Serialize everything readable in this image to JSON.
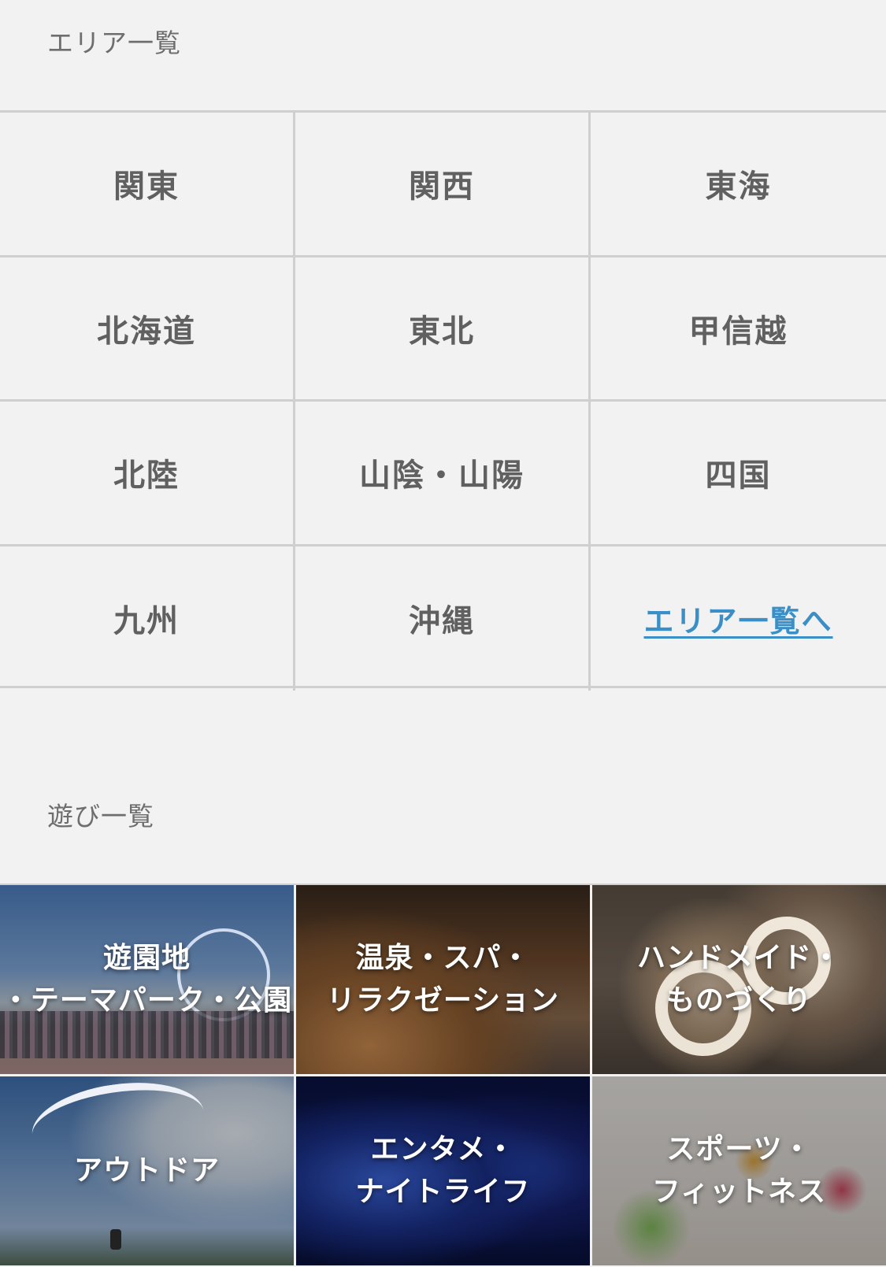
{
  "area_section": {
    "title": "エリア一覧",
    "items": [
      {
        "label": "関東"
      },
      {
        "label": "関西"
      },
      {
        "label": "東海"
      },
      {
        "label": "北海道"
      },
      {
        "label": "東北"
      },
      {
        "label": "甲信越"
      },
      {
        "label": "北陸"
      },
      {
        "label": "山陰・山陽"
      },
      {
        "label": "四国"
      },
      {
        "label": "九州"
      },
      {
        "label": "沖縄"
      }
    ],
    "more_link": "エリア一覧へ",
    "link_color": "#3a8fc7"
  },
  "play_section": {
    "title": "遊び一覧",
    "items": [
      {
        "label": "遊園地\n・テーマパーク・公園",
        "icon": "amusement-park-photo"
      },
      {
        "label": "温泉・スパ・\nリラクゼーション",
        "icon": "hot-spring-photo"
      },
      {
        "label": "ハンドメイド・\nものづくり",
        "icon": "handmade-craft-photo"
      },
      {
        "label": "アウトドア",
        "icon": "paraglider-photo"
      },
      {
        "label": "エンタメ・\nナイトライフ",
        "icon": "vr-entertainment-photo"
      },
      {
        "label": "スポーツ・\nフィットネス",
        "icon": "bouldering-photo"
      }
    ]
  }
}
